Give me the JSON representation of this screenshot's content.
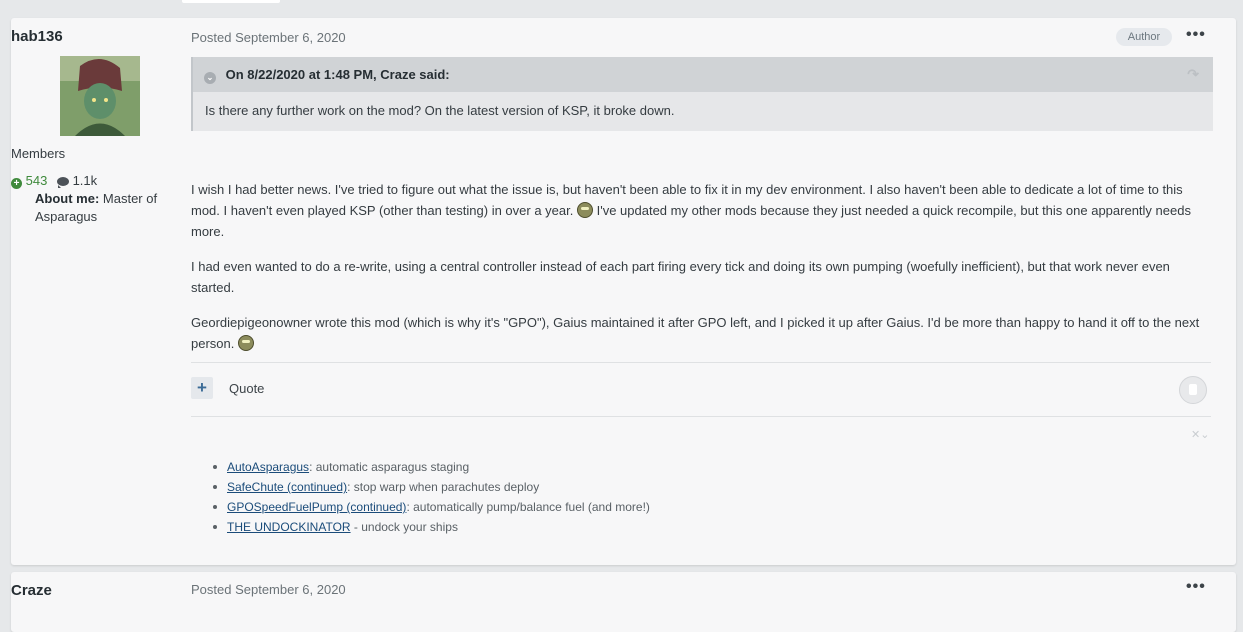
{
  "post1": {
    "author": "hab136",
    "group": "Members",
    "reputation": "543",
    "posts_count": "1.1k",
    "about_label": "About me:",
    "about_value": "Master of Asparagus",
    "posted": "Posted September 6, 2020",
    "author_badge": "Author",
    "more_icon": "•••",
    "quote": {
      "citation": "On 8/22/2020 at 1:48 PM, Craze said:",
      "text": "Is there any further work on the mod? On the latest version of KSP, it broke down."
    },
    "paragraphs": {
      "p1a": "I wish I had better news.  I've tried to figure out what the issue is, but haven't been able to fix it in my dev environment.  I also haven't been able to dedicate a lot of time to this mod.  I haven't even played KSP (other than testing) in over a year.",
      "p1b": "  I've updated my other mods because they just needed a quick recompile, but this one apparently needs more.",
      "p2": "I had even wanted to do a re-write, using a central controller instead of each part firing every tick and doing its own pumping (woefully inefficient), but that work never even started.",
      "p3": "Geordiepigeonowner wrote this mod (which is why it's \"GPO\"), Gaius maintained it after GPO left, and I picked it up after Gaius.  I'd be more than happy to hand it off to the next person."
    },
    "quote_button": "Quote",
    "plus_icon": "+",
    "signature": [
      {
        "link": "AutoAsparagus",
        "text": ": automatic asparagus staging"
      },
      {
        "link": "SafeChute (continued)",
        "text": ": stop warp when parachutes deploy"
      },
      {
        "link": "GPOSpeedFuelPump (continued)",
        "text": ": automatically pump/balance fuel (and more!)"
      },
      {
        "link": "THE UNDOCKINATOR",
        "text": " - undock your ships"
      }
    ]
  },
  "post2": {
    "author": "Craze",
    "posted": "Posted September 6, 2020",
    "more_icon": "•••"
  }
}
